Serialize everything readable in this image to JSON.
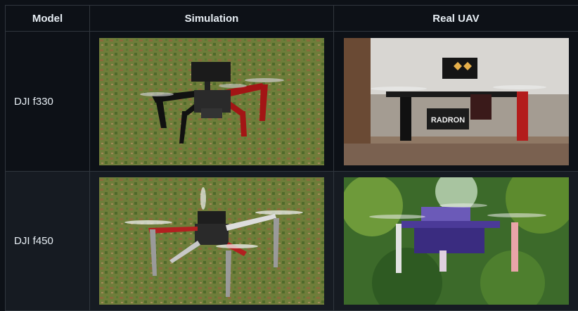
{
  "table": {
    "headers": [
      "Model",
      "Simulation",
      "Real UAV"
    ],
    "rows": [
      {
        "model": "DJI f330",
        "simulation_image": "DJI f330 drone in simulated grass field",
        "real_image": "DJI f330 drone hovering outdoors",
        "real_label": "RADRON"
      },
      {
        "model": "DJI f450",
        "simulation_image": "DJI f450 drone in simulated grass field",
        "real_image": "DJI f450 drone hovering in front of trees"
      }
    ]
  }
}
